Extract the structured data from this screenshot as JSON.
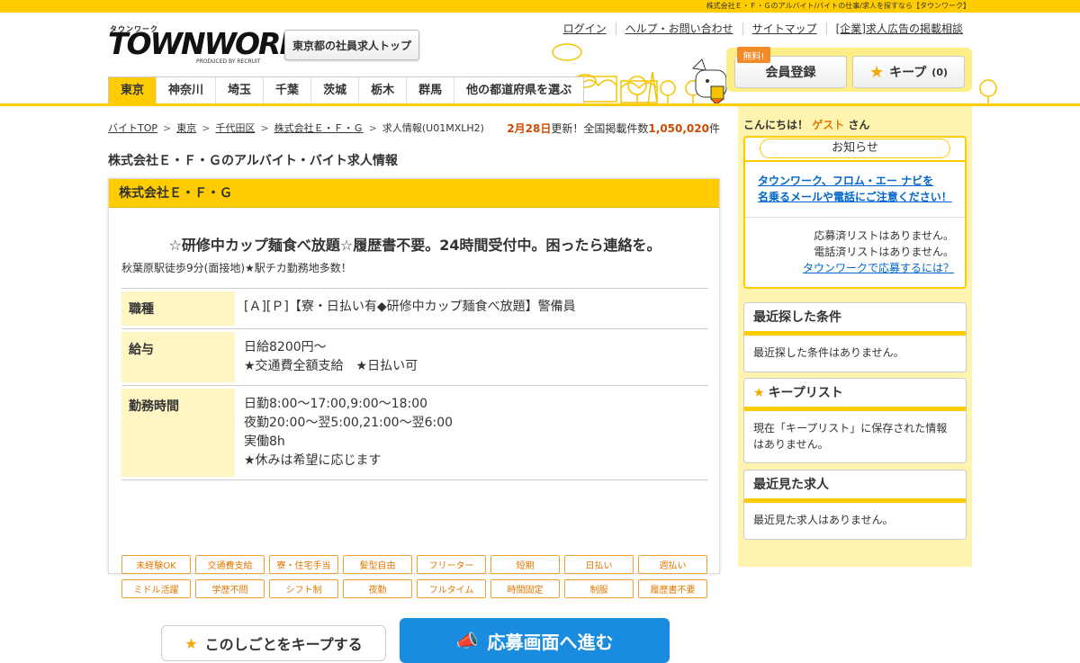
{
  "topbar": {
    "tagline": "株式会社Ｅ・Ｆ・Ｇのアルバイト/バイトの仕事/求人を探すなら【タウンワーク】"
  },
  "logo": {
    "small": "タウンワーク",
    "big": "TOWNWORK",
    "sub": "PRODUCED BY RECRUIT"
  },
  "header": {
    "tokyo_button": "東京都の社員求人トップ",
    "links": [
      "ログイン",
      "ヘルプ・お問い合わせ",
      "サイトマップ",
      "[企業]求人広告の掲載相談"
    ],
    "free_badge": "無料!",
    "member_button": "会員登録",
    "keep_button": "キープ",
    "keep_count": "(0)"
  },
  "nav": {
    "items": [
      "東京",
      "神奈川",
      "埼玉",
      "千葉",
      "茨城",
      "栃木",
      "群馬",
      "他の都道府県を選ぶ"
    ]
  },
  "breadcrumb": {
    "items": [
      "バイトTOP",
      "東京",
      "千代田区",
      "株式会社Ｅ・Ｆ・Ｇ"
    ],
    "current": "求人情報(U01MXLH2)"
  },
  "count": {
    "date": "2月28日",
    "mid": "更新！全国掲載件数",
    "number": "1,050,020",
    "unit": "件"
  },
  "page_title": "株式会社Ｅ・Ｆ・Ｇのアルバイト・バイト求人情報",
  "job": {
    "company": "株式会社Ｅ・Ｆ・Ｇ",
    "catch": "☆研修中カップ麺食べ放題☆履歴書不要。24時間受付中。困ったら連絡を。",
    "sub": "秋葉原駅徒歩9分(面接地)★駅チカ勤務地多数！",
    "rows": [
      {
        "label": "職種",
        "lines": [
          "[Ａ][Ｐ]【寮・日払い有◆研修中カップ麺食べ放題】警備員"
        ]
      },
      {
        "label": "給与",
        "lines": [
          "日給8200円～",
          "★交通費全額支給　★日払い可"
        ]
      },
      {
        "label": "勤務時間",
        "lines": [
          "日勤8:00～17:00,9:00～18:00",
          "夜勤20:00～翌5:00,21:00～翌6:00",
          "実働8h",
          "★休みは希望に応じます"
        ]
      }
    ],
    "tags": [
      "未経験OK",
      "交通費支給",
      "寮・住宅手当",
      "髪型自由",
      "フリーター",
      "短期",
      "日払い",
      "週払い",
      "ミドル活躍",
      "学歴不問",
      "シフト制",
      "夜勤",
      "フルタイム",
      "時間固定",
      "制服",
      "履歴書不要"
    ],
    "keep_label": "このしごとをキープする",
    "apply_label": "応募画面へ進む"
  },
  "side": {
    "hello_a": "こんにちは！",
    "guest": "ゲスト",
    "hello_b": "さん",
    "notice_title": "お知らせ",
    "notice_link1": "タウンワーク、フロム・エー ナビを",
    "notice_link2": "名乗るメールや電話にご注意ください！",
    "applied": "応募済リストはありません。",
    "called": "電話済リストはありません。",
    "howto": "タウンワークで応募するには？",
    "recent_search_title": "最近探した条件",
    "recent_search_body": "最近探した条件はありません。",
    "keep_list_title": "キープリスト",
    "keep_list_body": "現在「キープリスト」に保存された情報はありません。",
    "recent_view_title": "最近見た求人",
    "recent_view_body": "最近見た求人はありません。"
  },
  "colors": {
    "brand": "#ffcc00",
    "accent": "#e07800",
    "link": "#0066cc",
    "apply": "#1a8ce0"
  }
}
